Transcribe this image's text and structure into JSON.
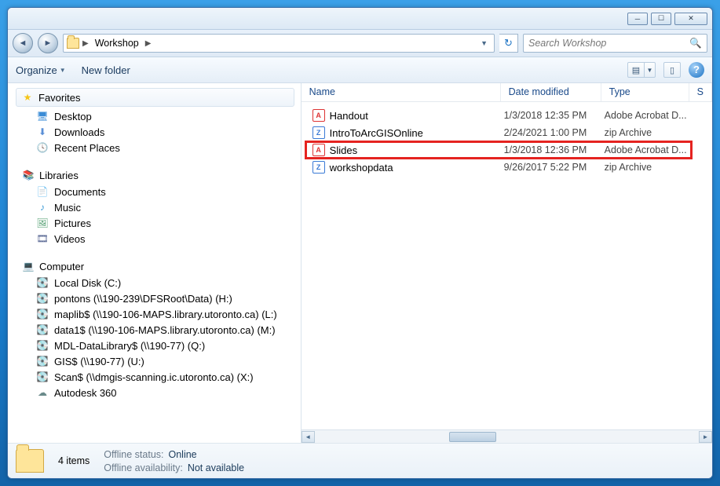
{
  "breadcrumb": {
    "folder": "Workshop"
  },
  "search": {
    "placeholder": "Search Workshop"
  },
  "toolbar": {
    "organize": "Organize",
    "new_folder": "New folder"
  },
  "columns": {
    "name": "Name",
    "date": "Date modified",
    "type": "Type",
    "size": "S"
  },
  "nav": {
    "favorites": "Favorites",
    "desktop": "Desktop",
    "downloads": "Downloads",
    "recent": "Recent Places",
    "libraries": "Libraries",
    "documents": "Documents",
    "music": "Music",
    "pictures": "Pictures",
    "videos": "Videos",
    "computer": "Computer",
    "drives": [
      "Local Disk (C:)",
      "pontons (\\\\190-239\\DFSRoot\\Data) (H:)",
      "maplib$ (\\\\190-106-MAPS.library.utoronto.ca) (L:)",
      "data1$ (\\\\190-106-MAPS.library.utoronto.ca) (M:)",
      "MDL-DataLibrary$ (\\\\190-77) (Q:)",
      "GIS$ (\\\\190-77) (U:)",
      "Scan$ (\\\\dmgis-scanning.ic.utoronto.ca) (X:)",
      "Autodesk 360"
    ]
  },
  "files": [
    {
      "name": "Handout",
      "date": "1/3/2018 12:35 PM",
      "type": "Adobe Acrobat D...",
      "icon": "pdf"
    },
    {
      "name": "IntroToArcGISOnline",
      "date": "2/24/2021 1:00 PM",
      "type": "zip Archive",
      "icon": "zip"
    },
    {
      "name": "Slides",
      "date": "1/3/2018 12:36 PM",
      "type": "Adobe Acrobat D...",
      "icon": "pdf"
    },
    {
      "name": "workshopdata",
      "date": "9/26/2017 5:22 PM",
      "type": "zip Archive",
      "icon": "zip"
    }
  ],
  "status": {
    "count": "4 items",
    "offline_status_label": "Offline status:",
    "offline_status_value": "Online",
    "offline_avail_label": "Offline availability:",
    "offline_avail_value": "Not available"
  }
}
